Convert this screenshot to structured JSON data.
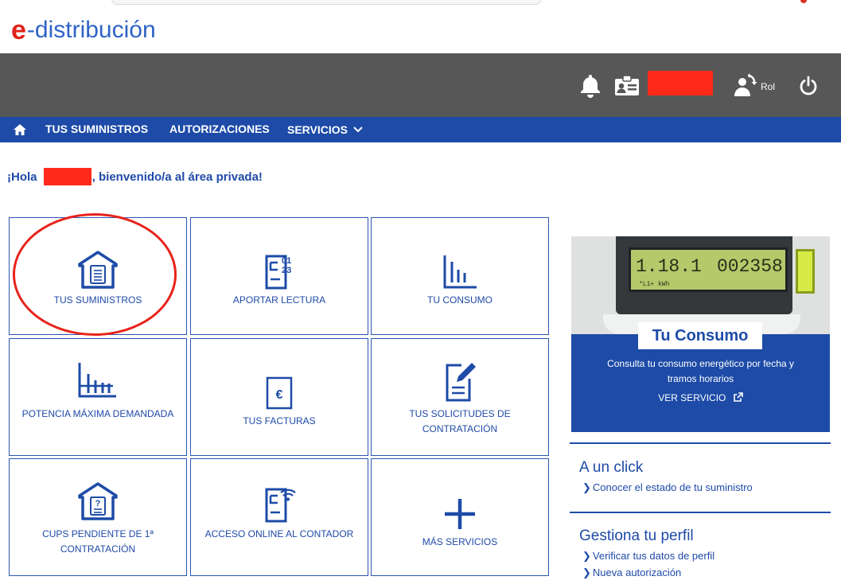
{
  "brand": {
    "logo_e": "e",
    "logo_text": "-distribución",
    "accent": "#e2231a",
    "primary": "#1d4ba7"
  },
  "header": {
    "role_label": "Rol"
  },
  "nav": {
    "items": [
      "TUS SUMINISTROS",
      "AUTORIZACIONES",
      "SERVICIOS"
    ]
  },
  "greeting": {
    "before": "¡Hola ",
    "after": ", bienvenido/a al área privada!"
  },
  "tiles": [
    {
      "icon": "house-document-icon",
      "label": "TUS SUMINISTROS"
    },
    {
      "icon": "meter-reading-icon",
      "label": "APORTAR LECTURA"
    },
    {
      "icon": "bar-chart-icon",
      "label": "TU CONSUMO"
    },
    {
      "icon": "max-power-chart-icon",
      "label": "POTENCIA MÁXIMA DEMANDADA"
    },
    {
      "icon": "euro-invoice-icon",
      "label": "TUS FACTURAS"
    },
    {
      "icon": "edit-document-icon",
      "label": "TUS SOLICITUDES DE CONTRATACIÓN"
    },
    {
      "icon": "house-question-icon",
      "label": "CUPS PENDIENTE DE 1ª CONTRATACIÓN"
    },
    {
      "icon": "wifi-document-icon",
      "label": "ACCESO ONLINE AL CONTADOR"
    },
    {
      "icon": "plus-icon",
      "label": "MÁS SERVICIOS"
    }
  ],
  "promo": {
    "lcd_left": "1.18.1",
    "lcd_right": "002358",
    "lcd_small": "*L1+    kWh",
    "badge": "Tu Consumo",
    "desc": "Consulta tu consumo energético por fecha y tramos horarios",
    "link": "VER SERVICIO"
  },
  "side": {
    "section1": {
      "title": "A un click",
      "links": [
        "Conocer el estado de tu suministro"
      ]
    },
    "section2": {
      "title": "Gestiona tu perfil",
      "links": [
        "Verificar tus datos de perfil",
        "Nueva autorización"
      ]
    }
  }
}
